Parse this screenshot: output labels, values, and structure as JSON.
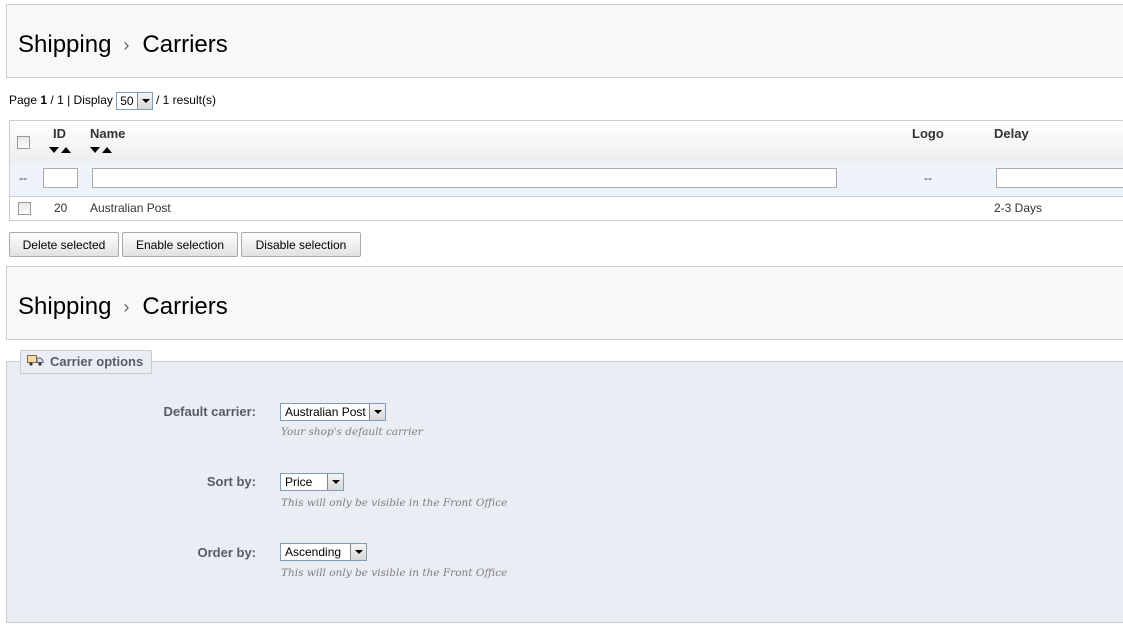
{
  "breadcrumb": {
    "section": "Shipping",
    "separator": "›",
    "page": "Carriers"
  },
  "pagination": {
    "page_label": "Page",
    "current_page": "1",
    "total_pages": "/ 1",
    "display_label": "| Display",
    "display_value": "50",
    "results_text": "/ 1 result(s)"
  },
  "table": {
    "columns": {
      "id": "ID",
      "name": "Name",
      "logo": "Logo",
      "delay": "Delay"
    },
    "filter": {
      "checkbox_placeholder": "--",
      "logo_placeholder": "--"
    },
    "rows": [
      {
        "id": "20",
        "name": "Australian Post",
        "delay": "2-3 Days"
      }
    ]
  },
  "actions": {
    "delete": "Delete selected",
    "enable": "Enable selection",
    "disable": "Disable selection"
  },
  "carrier_options": {
    "legend": "Carrier options",
    "default_carrier": {
      "label": "Default carrier:",
      "value": "Australian Post",
      "hint": "Your shop's default carrier"
    },
    "sort_by": {
      "label": "Sort by:",
      "value": "Price",
      "hint": "This will only be visible in the Front Office"
    },
    "order_by": {
      "label": "Order by:",
      "value": "Ascending",
      "hint": "This will only be visible in the Front Office"
    }
  }
}
